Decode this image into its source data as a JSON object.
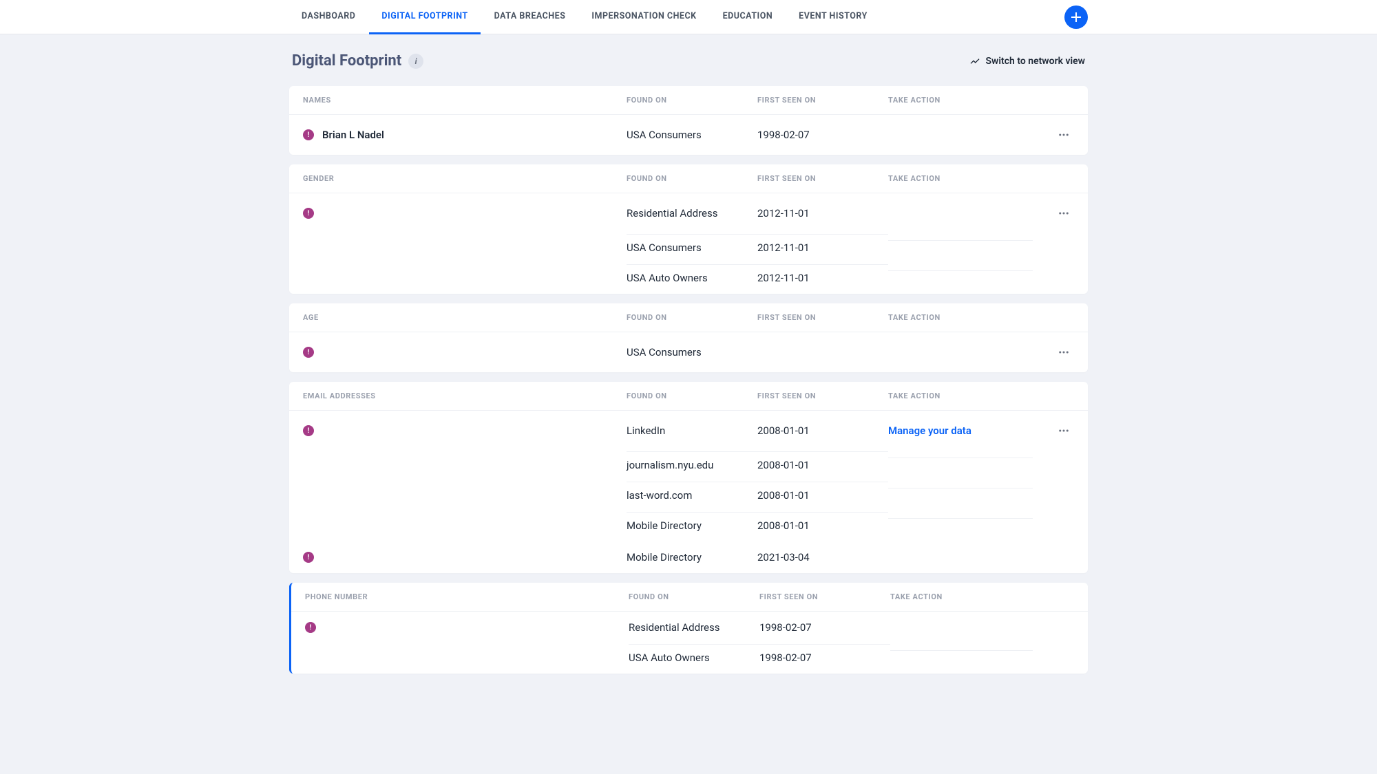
{
  "nav": {
    "tabs": [
      {
        "label": "DASHBOARD",
        "active": false
      },
      {
        "label": "DIGITAL FOOTPRINT",
        "active": true
      },
      {
        "label": "DATA BREACHES",
        "active": false
      },
      {
        "label": "IMPERSONATION CHECK",
        "active": false
      },
      {
        "label": "EDUCATION",
        "active": false
      },
      {
        "label": "EVENT HISTORY",
        "active": false
      }
    ]
  },
  "header": {
    "title": "Digital Footprint",
    "switch_label": "Switch to network view"
  },
  "columns": {
    "found_on": "FOUND ON",
    "first_seen": "FIRST SEEN ON",
    "take_action": "TAKE ACTION"
  },
  "sections": [
    {
      "heading": "NAMES",
      "accent": false,
      "groups": [
        {
          "show_more": true,
          "name": "Brian L Nadel",
          "rows": [
            {
              "found_on": "USA Consumers",
              "first_seen": "1998-02-07",
              "action": ""
            }
          ]
        }
      ]
    },
    {
      "heading": "GENDER",
      "accent": false,
      "groups": [
        {
          "show_more": true,
          "name": "",
          "rows": [
            {
              "found_on": "Residential Address",
              "first_seen": "2012-11-01",
              "action": ""
            },
            {
              "found_on": "USA Consumers",
              "first_seen": "2012-11-01",
              "action": ""
            },
            {
              "found_on": "USA Auto Owners",
              "first_seen": "2012-11-01",
              "action": ""
            }
          ]
        }
      ]
    },
    {
      "heading": "AGE",
      "accent": false,
      "groups": [
        {
          "show_more": true,
          "name": "",
          "rows": [
            {
              "found_on": "USA Consumers",
              "first_seen": "",
              "action": ""
            }
          ]
        }
      ]
    },
    {
      "heading": "EMAIL ADDRESSES",
      "accent": false,
      "groups": [
        {
          "show_more": true,
          "name": "",
          "rows": [
            {
              "found_on": "LinkedIn",
              "first_seen": "2008-01-01",
              "action": "Manage your data"
            },
            {
              "found_on": "journalism.nyu.edu",
              "first_seen": "2008-01-01",
              "action": ""
            },
            {
              "found_on": "last-word.com",
              "first_seen": "2008-01-01",
              "action": ""
            },
            {
              "found_on": "Mobile Directory",
              "first_seen": "2008-01-01",
              "action": ""
            }
          ]
        },
        {
          "show_more": false,
          "name": "",
          "rows": [
            {
              "found_on": "Mobile Directory",
              "first_seen": "2021-03-04",
              "action": ""
            }
          ]
        }
      ]
    },
    {
      "heading": "PHONE NUMBER",
      "accent": true,
      "groups": [
        {
          "show_more": false,
          "name": "",
          "rows": [
            {
              "found_on": "Residential Address",
              "first_seen": "1998-02-07",
              "action": ""
            },
            {
              "found_on": "USA Auto Owners",
              "first_seen": "1998-02-07",
              "action": ""
            }
          ]
        }
      ]
    }
  ]
}
